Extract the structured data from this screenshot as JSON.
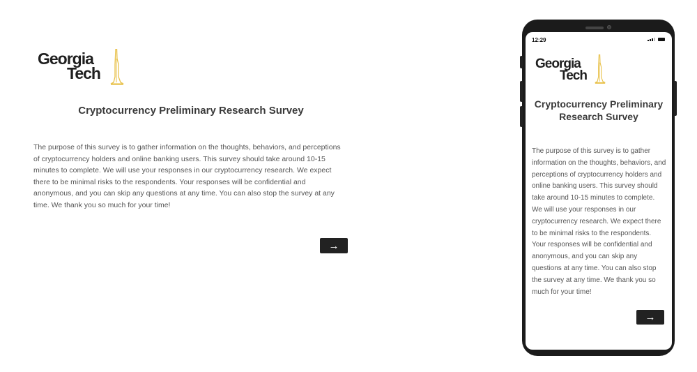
{
  "survey": {
    "logo": {
      "line1": "Georgia",
      "line2": "Tech"
    },
    "title": "Cryptocurrency Preliminary Research Survey",
    "intro": "The purpose of this survey is to gather information on the thoughts, behaviors, and perceptions of cryptocurrency holders and online banking users. This survey should take around 10-15 minutes to complete. We will use your responses in our cryptocurrency research. We expect there to be minimal risks to the respondents. Your responses will be confidential and anonymous, and you can skip any questions at any time. You can also stop the survey at any time. We thank you so much for your time!",
    "next_label": "→"
  },
  "mobile": {
    "status_time": "12:29"
  },
  "colors": {
    "logo_gold": "#e8c14a",
    "button_bg": "#222222"
  }
}
